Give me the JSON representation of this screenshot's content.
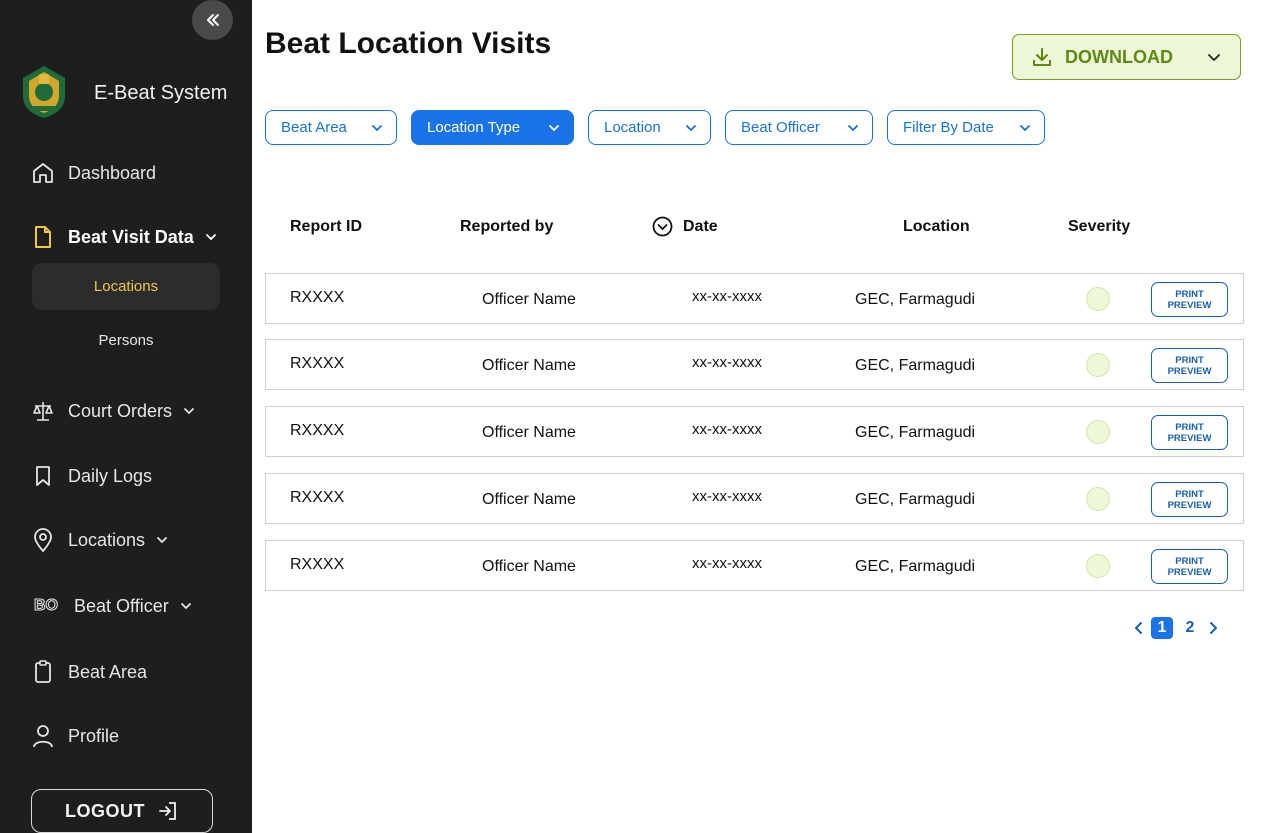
{
  "sidebar": {
    "brand_title": "E-Beat System",
    "nav": [
      {
        "label": "Dashboard"
      },
      {
        "label": "Beat Visit Data"
      },
      {
        "label": "Court Orders"
      },
      {
        "label": "Daily Logs"
      },
      {
        "label": "Locations"
      },
      {
        "label": "Beat Officer"
      },
      {
        "label": "Beat Area"
      },
      {
        "label": "Profile"
      }
    ],
    "sub_items": [
      {
        "label": "Locations"
      },
      {
        "label": "Persons"
      }
    ],
    "logout_label": "LOGOUT",
    "bo_icon_text": "BO"
  },
  "header": {
    "title": "Beat Location Visits",
    "download_label": "DOWNLOAD"
  },
  "filters": [
    {
      "label": "Beat Area"
    },
    {
      "label": "Location Type"
    },
    {
      "label": "Location"
    },
    {
      "label": "Beat Officer"
    },
    {
      "label": "Filter By Date"
    }
  ],
  "table": {
    "columns": {
      "report_id": "Report ID",
      "reported_by": "Reported by",
      "date": "Date",
      "location": "Location",
      "severity": "Severity"
    },
    "rows": [
      {
        "id": "RXXXX",
        "officer": "Officer Name",
        "date": "xx-xx-xxxx",
        "location": "GEC, Farmagudi",
        "print_l1": "PRINT",
        "print_l2": "PREVIEW"
      },
      {
        "id": "RXXXX",
        "officer": "Officer Name",
        "date": "xx-xx-xxxx",
        "location": "GEC, Farmagudi",
        "print_l1": "PRINT",
        "print_l2": "PREVIEW"
      },
      {
        "id": "RXXXX",
        "officer": "Officer Name",
        "date": "xx-xx-xxxx",
        "location": "GEC, Farmagudi",
        "print_l1": "PRINT",
        "print_l2": "PREVIEW"
      },
      {
        "id": "RXXXX",
        "officer": "Officer Name",
        "date": "xx-xx-xxxx",
        "location": "GEC, Farmagudi",
        "print_l1": "PRINT",
        "print_l2": "PREVIEW"
      },
      {
        "id": "RXXXX",
        "officer": "Officer Name",
        "date": "xx-xx-xxxx",
        "location": "GEC, Farmagudi",
        "print_l1": "PRINT",
        "print_l2": "PREVIEW"
      }
    ]
  },
  "pagination": {
    "pages": [
      "1",
      "2"
    ]
  },
  "colors": {
    "sidebar_bg": "#1e1e1e",
    "accent_blue": "#1a73e8",
    "active_sub_text": "#f2c744",
    "download_green": "#5f8a12",
    "severity_dot": "#edf8d8"
  }
}
